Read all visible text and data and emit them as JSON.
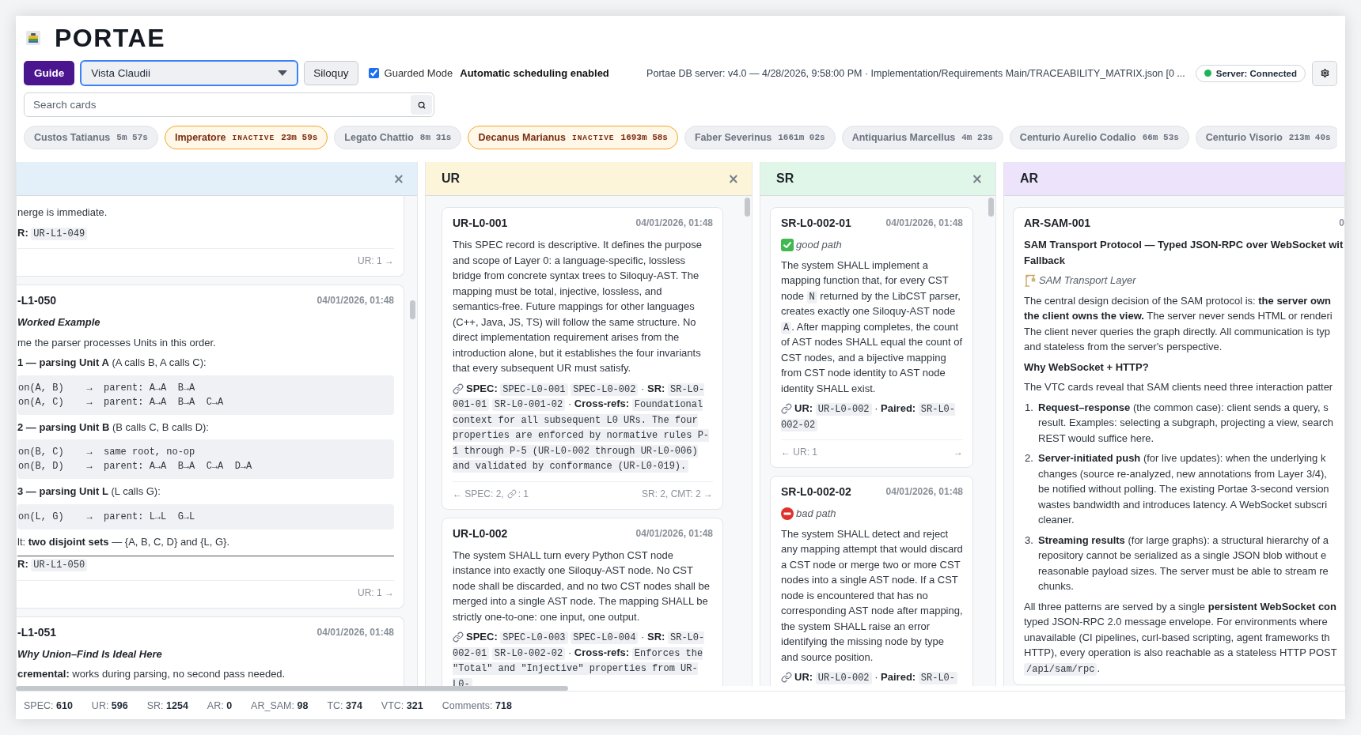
{
  "app": {
    "title": "PORTAE"
  },
  "toolbar": {
    "guide_button": "Guide",
    "view_select": {
      "value": "Vista Claudii"
    },
    "siloquy_button": "Siloquy",
    "guarded_mode": {
      "label": "Guarded Mode",
      "checked": true
    },
    "scheduling_status": "Automatic scheduling enabled",
    "server_info": "Portae DB server: v4.0 — 4/28/2026, 9:58:00 PM · Implementation/Requirements Main/TRACEABILITY_MATRIX.json [0 ...",
    "connection": {
      "label": "Server: Connected",
      "connected": true
    }
  },
  "search": {
    "placeholder": "Search cards"
  },
  "agents": [
    {
      "name": "Custos Tatianus",
      "inactive": false,
      "elapsed": "5m 57s"
    },
    {
      "name": "Imperatore",
      "inactive": true,
      "badge": "INACTIVE",
      "elapsed": "23m 59s"
    },
    {
      "name": "Legato Chattio",
      "inactive": false,
      "elapsed": "8m 31s"
    },
    {
      "name": "Decanus Marianus",
      "inactive": true,
      "badge": "INACTIVE",
      "elapsed": "1693m 58s"
    },
    {
      "name": "Faber Severinus",
      "inactive": false,
      "elapsed": "1661m 02s"
    },
    {
      "name": "Antiquarius Marcellus",
      "inactive": false,
      "elapsed": "4m 23s"
    },
    {
      "name": "Centurio Aurelio Codalio",
      "inactive": false,
      "elapsed": "66m 53s"
    },
    {
      "name": "Centurio Visorio",
      "inactive": false,
      "elapsed": "213m 40s"
    }
  ],
  "columns": [
    {
      "color": "#e3f0fa",
      "close_label": "×",
      "cards": [
        {
          "blocks": [
            {
              "kind": "cut_para",
              "lines": [
                [
                  {
                    "kind": "text",
                    "text": "nerge is immediate."
                  }
                ]
              ]
            },
            {
              "kind": "cut_para",
              "lines": [
                [
                  {
                    "kind": "text",
                    "text": "**R:** "
                  },
                  {
                    "kind": "code",
                    "text": "UR-L1-049"
                  }
                ]
              ]
            }
          ],
          "forward_link": "UR: 1 →"
        },
        {
          "id": "-L1-050",
          "date": "04/01/2026, 01:48",
          "blocks": [
            {
              "kind": "heading",
              "text": "Worked Example"
            },
            {
              "kind": "cut_para",
              "lines": [
                [
                  {
                    "kind": "text",
                    "text": "me the parser processes Units in this order."
                  }
                ]
              ]
            },
            {
              "kind": "cut_para",
              "lines": [
                [
                  {
                    "kind": "text",
                    "text": "**1 — parsing Unit A** (A calls B, A calls C):"
                  }
                ]
              ]
            },
            {
              "kind": "code",
              "lines": [
                "on(A, B)    →  parent: A→A  B→A",
                "on(A, C)    →  parent: A→A  B→A  C→A"
              ]
            },
            {
              "kind": "cut_para",
              "lines": [
                [
                  {
                    "kind": "text",
                    "text": "**2 — parsing Unit B** (B calls C, B calls D):"
                  }
                ]
              ]
            },
            {
              "kind": "code",
              "lines": [
                "on(B, C)    →  same root, no-op",
                "on(B, D)    →  parent: A→A  B→A  C→A  D→A"
              ]
            },
            {
              "kind": "cut_para",
              "lines": [
                [
                  {
                    "kind": "text",
                    "text": "**3 — parsing Unit L** (L calls G):"
                  }
                ]
              ]
            },
            {
              "kind": "code",
              "lines": [
                "on(L, G)    →  parent: L→L  G→L"
              ]
            },
            {
              "kind": "cut_para",
              "lines": [
                [
                  {
                    "kind": "text",
                    "text": "lt: **two disjoint sets** — {A, B, C, D} and {L, G}."
                  }
                ]
              ]
            },
            {
              "kind": "rule"
            },
            {
              "kind": "cut_para",
              "lines": [
                [
                  {
                    "kind": "text",
                    "text": "**R:** "
                  },
                  {
                    "kind": "code",
                    "text": "UR-L1-050"
                  }
                ]
              ]
            }
          ],
          "forward_link": "UR: 1 →"
        },
        {
          "id": "-L1-051",
          "date": "04/01/2026, 01:48",
          "blocks": [
            {
              "kind": "heading",
              "text": "Why Union–Find Is Ideal Here"
            },
            {
              "kind": "cut_para",
              "lines": [
                [
                  {
                    "kind": "text",
                    "text": "**cremental:** works during parsing, no second pass needed."
                  }
                ]
              ]
            }
          ]
        }
      ]
    },
    {
      "title": "UR",
      "color": "#fcf5da",
      "close_label": "×",
      "cards": [
        {
          "id": "UR-L0-001",
          "date": "04/01/2026, 01:48",
          "blocks": [
            {
              "kind": "para",
              "segments": [
                {
                  "kind": "text",
                  "text": "This SPEC record is descriptive. It defines the purpose and scope of Layer 0: a language-specific, lossless bridge from concrete syntax trees to Siloquy-AST. The mapping must be total, injective, lossless, and semantics-free. Future mappings for other languages (C++, Java, JS, TS) will follow the same structure. No direct implementation requirement arises from the introduction alone, but it establishes the four invariants that every subsequent UR must satisfy."
                }
              ]
            },
            {
              "kind": "refs",
              "segments": [
                {
                  "kind": "text",
                  "text": "**SPEC:** "
                },
                {
                  "kind": "code",
                  "text": "SPEC-L0-001"
                },
                {
                  "kind": "code",
                  "text": "SPEC-L0-002"
                },
                {
                  "kind": "text",
                  "text": " · **SR:** "
                },
                {
                  "kind": "code",
                  "text": "SR-L0-001-01"
                },
                {
                  "kind": "code",
                  "text": "SR-L0-001-02"
                },
                {
                  "kind": "text",
                  "text": " · **Cross-refs:** "
                },
                {
                  "kind": "code",
                  "text": "Foundational context for all subsequent L0 URs. The four properties are enforced by normative rules P-1 through P-5 (UR-L0-002 through UR-L0-006) and validated by conformance (UR-L0-019)."
                }
              ]
            }
          ],
          "back_link": {
            "label": "← SPEC: 2,",
            "links": ": 1"
          },
          "forward_link": "SR: 2, CMT: 2 →"
        },
        {
          "id": "UR-L0-002",
          "date": "04/01/2026, 01:48",
          "blocks": [
            {
              "kind": "para",
              "segments": [
                {
                  "kind": "text",
                  "text": "The system SHALL turn every Python CST node instance into exactly one Siloquy-AST node. No CST node shall be discarded, and no two CST nodes shall be merged into a single AST node. The mapping SHALL be strictly one-to-one: one input, one output."
                }
              ]
            },
            {
              "kind": "refs",
              "segments": [
                {
                  "kind": "text",
                  "text": "**SPEC:** "
                },
                {
                  "kind": "code",
                  "text": "SPEC-L0-003"
                },
                {
                  "kind": "code",
                  "text": "SPEC-L0-004"
                },
                {
                  "kind": "text",
                  "text": " · **SR:** "
                },
                {
                  "kind": "code",
                  "text": "SR-L0-002-01"
                },
                {
                  "kind": "code",
                  "text": "SR-L0-002-02"
                },
                {
                  "kind": "text",
                  "text": " · **Cross-refs:** "
                },
                {
                  "kind": "code",
                  "text": "Enforces the \"Total\" and \"Injective\" properties from UR-L0-"
                }
              ]
            }
          ]
        }
      ]
    },
    {
      "title": "SR",
      "color": "#e0f6e9",
      "close_label": "×",
      "cards": [
        {
          "id": "SR-L0-002-01",
          "date": "04/01/2026, 01:48",
          "blocks": [
            {
              "kind": "verdict",
              "passing": true,
              "text": "good path"
            },
            {
              "kind": "para",
              "segments": [
                {
                  "kind": "text",
                  "text": "The system SHALL implement a mapping function that, for every CST node "
                },
                {
                  "kind": "code",
                  "text": "N"
                },
                {
                  "kind": "text",
                  "text": " returned by the LibCST parser, creates exactly one Siloquy-AST node "
                },
                {
                  "kind": "code",
                  "text": "A"
                },
                {
                  "kind": "text",
                  "text": ". After mapping completes, the count of AST nodes SHALL equal the count of CST nodes, and a bijective mapping from CST node identity to AST node identity SHALL exist."
                }
              ]
            },
            {
              "kind": "refs",
              "segments": [
                {
                  "kind": "text",
                  "text": "**UR:** "
                },
                {
                  "kind": "code",
                  "text": "UR-L0-002"
                },
                {
                  "kind": "text",
                  "text": " · **Paired:** "
                },
                {
                  "kind": "code",
                  "text": "SR-L0-002-02"
                }
              ]
            }
          ],
          "back_link": {
            "label": "← UR: 1"
          },
          "forward_link": "→"
        },
        {
          "id": "SR-L0-002-02",
          "date": "04/01/2026, 01:48",
          "blocks": [
            {
              "kind": "verdict",
              "passing": false,
              "text": "bad path"
            },
            {
              "kind": "para",
              "segments": [
                {
                  "kind": "text",
                  "text": "The system SHALL detect and reject any mapping attempt that would discard a CST node or merge two or more CST nodes into a single AST node. If a CST node is encountered that has no corresponding AST node after mapping, the system SHALL raise an error identifying the missing node by type and source position."
                }
              ]
            },
            {
              "kind": "refs",
              "segments": [
                {
                  "kind": "text",
                  "text": "**UR:** "
                },
                {
                  "kind": "code",
                  "text": "UR-L0-002"
                },
                {
                  "kind": "text",
                  "text": " · **Paired:** "
                },
                {
                  "kind": "code",
                  "text": "SR-L0-"
                }
              ]
            }
          ]
        }
      ]
    },
    {
      "title": "AR",
      "color": "#ede4fb",
      "cards": [
        {
          "id": "AR-SAM-001",
          "date": "0",
          "blocks": [
            {
              "kind": "title",
              "lines": [
                "SAM Transport Protocol — Typed JSON-RPC over WebSocket wit",
                "Fallback"
              ]
            },
            {
              "kind": "layer",
              "text": "SAM Transport Layer"
            },
            {
              "kind": "cut_para",
              "lines": [
                [
                  {
                    "kind": "text",
                    "text": "The central design decision of the SAM protocol is: **the server own**"
                  }
                ],
                [
                  {
                    "kind": "text",
                    "text": "**the client owns the view.** The server never sends HTML or renderi"
                  }
                ],
                [
                  {
                    "kind": "text",
                    "text": "The client never queries the graph directly. All communication is typ"
                  }
                ],
                [
                  {
                    "kind": "text",
                    "text": "and stateless from the server's perspective."
                  }
                ]
              ]
            },
            {
              "kind": "subheading",
              "text": "Why WebSocket + HTTP?"
            },
            {
              "kind": "cut_para",
              "lines": [
                [
                  {
                    "kind": "text",
                    "text": "The VTC cards reveal that SAM clients need three interaction patter"
                  }
                ]
              ]
            },
            {
              "kind": "list_item",
              "number": "1.",
              "lines": [
                [
                  {
                    "kind": "text",
                    "text": "**Request–response** (the common case): client sends a query, s"
                  }
                ],
                [
                  {
                    "kind": "text",
                    "text": "result. Examples: selecting a subgraph, projecting a view, search"
                  }
                ],
                [
                  {
                    "kind": "text",
                    "text": "REST would suffice here."
                  }
                ]
              ]
            },
            {
              "kind": "list_item",
              "number": "2.",
              "lines": [
                [
                  {
                    "kind": "text",
                    "text": "**Server-initiated push** (for live updates): when the underlying k"
                  }
                ],
                [
                  {
                    "kind": "text",
                    "text": "changes (source re-analyzed, new annotations from Layer 3/4),"
                  }
                ],
                [
                  {
                    "kind": "text",
                    "text": "be notified without polling. The existing Portae 3-second version"
                  }
                ],
                [
                  {
                    "kind": "text",
                    "text": "wastes bandwidth and introduces latency. A WebSocket subscri"
                  }
                ],
                [
                  {
                    "kind": "text",
                    "text": "cleaner."
                  }
                ]
              ]
            },
            {
              "kind": "list_item",
              "number": "3.",
              "lines": [
                [
                  {
                    "kind": "text",
                    "text": "**Streaming results** (for large graphs): a structural hierarchy of a"
                  }
                ],
                [
                  {
                    "kind": "text",
                    "text": "repository cannot be serialized as a single JSON blob without e"
                  }
                ],
                [
                  {
                    "kind": "text",
                    "text": "reasonable payload sizes. The server must be able to stream re"
                  }
                ],
                [
                  {
                    "kind": "text",
                    "text": "chunks."
                  }
                ]
              ]
            },
            {
              "kind": "cut_para",
              "lines": [
                [
                  {
                    "kind": "text",
                    "text": "All three patterns are served by a single **persistent WebSocket con**"
                  }
                ],
                [
                  {
                    "kind": "text",
                    "text": "typed JSON-RPC 2.0 message envelope. For environments where"
                  }
                ],
                [
                  {
                    "kind": "text",
                    "text": "unavailable (CI pipelines, curl-based scripting, agent frameworks th"
                  }
                ],
                [
                  {
                    "kind": "text",
                    "text": "HTTP), every operation is also reachable as a stateless HTTP POST"
                  }
                ],
                [
                  {
                    "kind": "code",
                    "text": "/api/sam/rpc"
                  },
                  {
                    "kind": "text",
                    "text": "."
                  }
                ]
              ]
            }
          ]
        }
      ]
    }
  ],
  "status_bar": {
    "stats": [
      "SPEC: **610**",
      "UR: **596**",
      "SR: **1254**",
      "AR: **0**",
      "AR_SAM: **98**",
      "TC: **374**",
      "VTC: **321**",
      "Comments: **718**"
    ]
  }
}
